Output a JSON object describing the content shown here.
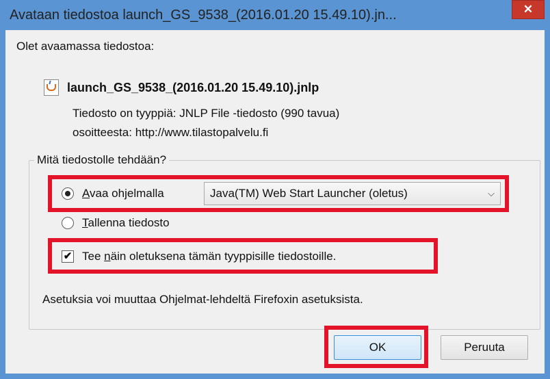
{
  "window": {
    "title": "Avataan tiedostoa launch_GS_9538_(2016.01.20 15.49.10).jn...",
    "close_glyph": "✕"
  },
  "intro": "Olet avaamassa tiedostoa:",
  "file": {
    "icon": "java-file-icon",
    "name": "launch_GS_9538_(2016.01.20 15.49.10).jnlp",
    "type_label": "Tiedosto on tyyppiä:",
    "type_value": "JNLP File -tiedosto (990 tavua)",
    "source_label": "osoitteesta:",
    "source_value": "http://www.tilastopalvelu.fi"
  },
  "action_group": {
    "legend": "Mitä tiedostolle tehdään?",
    "open_with": {
      "accel": "A",
      "label_rest": "vaa ohjelmalla",
      "selected": true,
      "app": "Java(TM) Web Start Launcher (oletus)"
    },
    "save": {
      "accel": "T",
      "label_rest": "allenna tiedosto",
      "selected": false
    },
    "remember": {
      "before": "Tee ",
      "accel": "n",
      "after": "äin oletuksena tämän tyyppisille tiedostoille.",
      "checked": true,
      "check_glyph": "✔"
    },
    "note": "Asetuksia voi muuttaa Ohjelmat-lehdeltä Firefoxin asetuksista."
  },
  "buttons": {
    "ok": "OK",
    "cancel": "Peruuta"
  },
  "colors": {
    "titlebar": "#5a94d3",
    "close": "#c7382b",
    "highlight": "#e3142a",
    "dialog_bg": "#f0f0f0"
  }
}
